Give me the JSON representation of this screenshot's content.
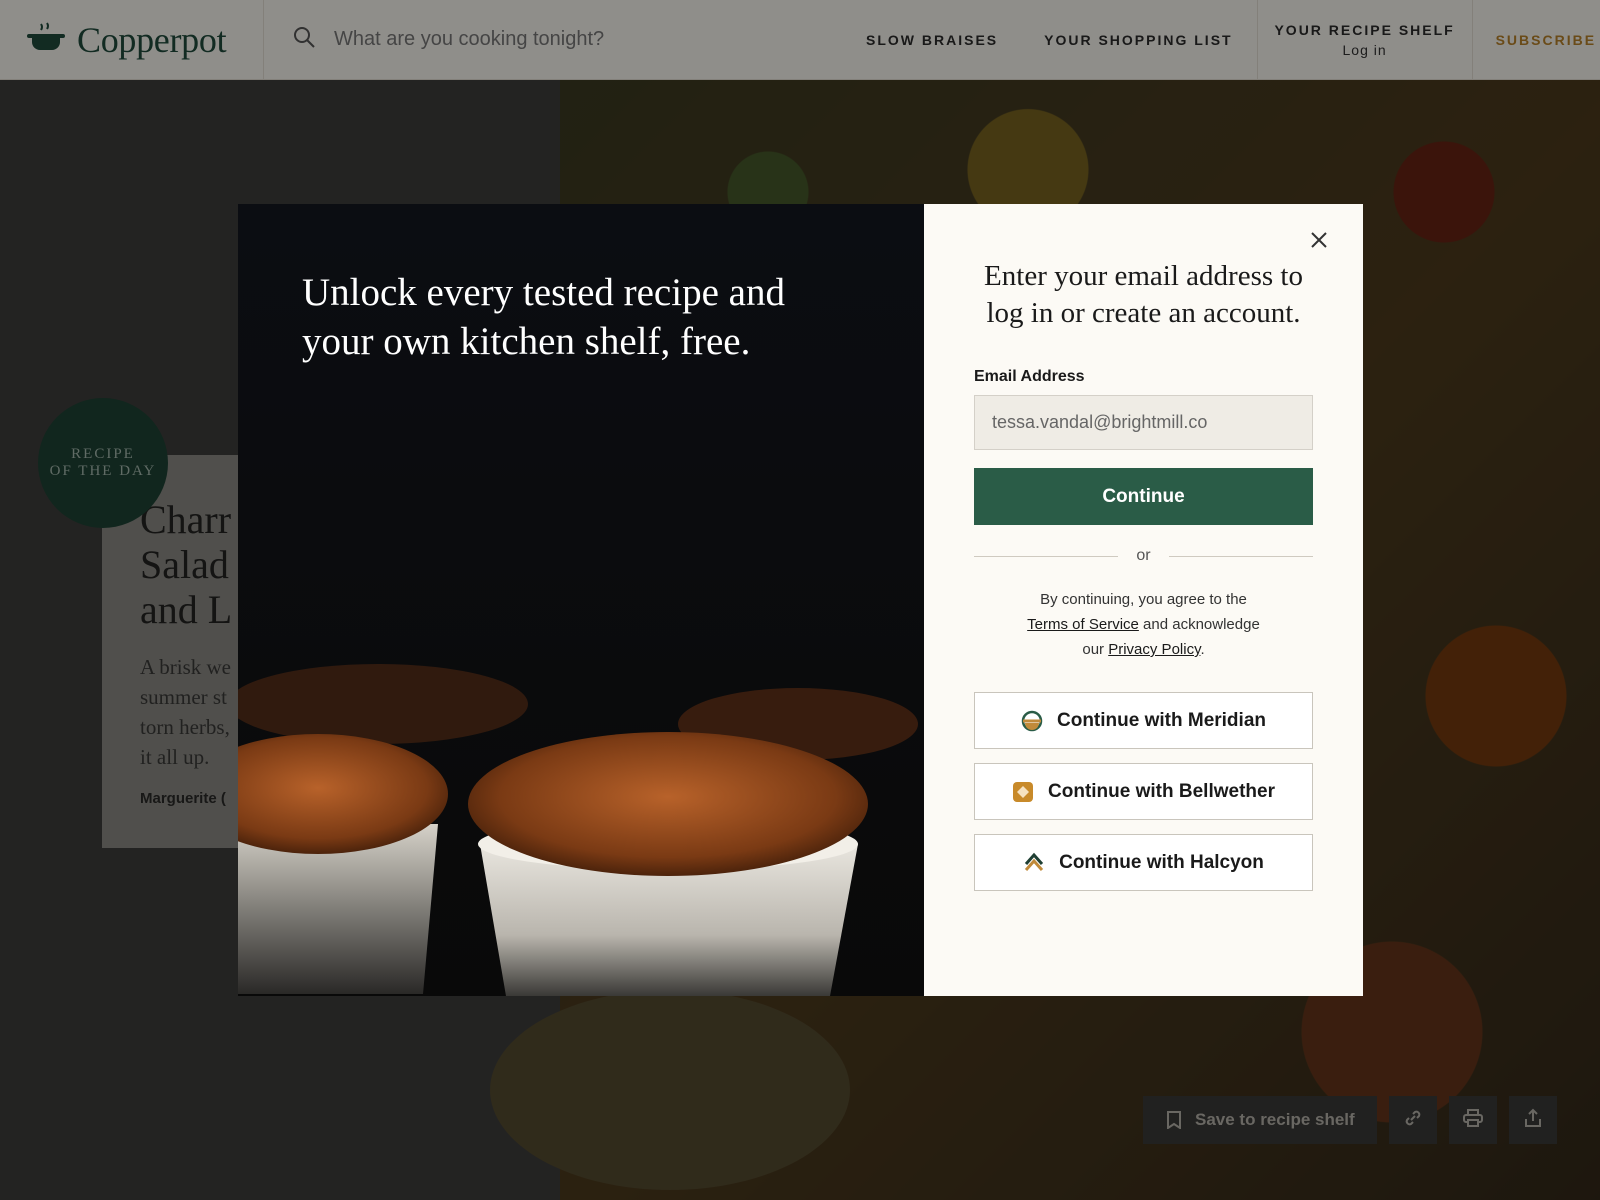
{
  "header": {
    "logo_text": "Copperpot",
    "search_placeholder": "What are you cooking tonight?",
    "nav": {
      "slow_braises": "SLOW BRAISES",
      "shopping_list": "YOUR SHOPPING LIST",
      "recipe_shelf": "YOUR RECIPE SHELF",
      "recipe_shelf_sub": "Log in",
      "subscribe": "SUBSCRIBE"
    }
  },
  "background": {
    "badge_line1": "RECIPE",
    "badge_line2": "OF THE DAY",
    "recipe_title_l1": "Charr",
    "recipe_title_l2": "Salad",
    "recipe_title_l3": "and L",
    "recipe_desc_l1": "A brisk we",
    "recipe_desc_l2": "summer st",
    "recipe_desc_l3": "torn herbs,",
    "recipe_desc_l4": "it all up.",
    "recipe_author": "Marguerite (",
    "save_label": "Save to recipe shelf"
  },
  "modal": {
    "hero_text": "Unlock every tested recipe and your own kitchen shelf, free.",
    "prompt": "Enter your email address to log in or create an account.",
    "email_label": "Email Address",
    "email_value": "tessa.vandal@brightmill.co",
    "continue_label": "Continue",
    "or_text": "or",
    "legal_pre": "By continuing, you agree to the",
    "terms_link": "Terms of Service",
    "legal_mid": "and acknowledge",
    "legal_our": "our",
    "privacy_link": "Privacy Policy",
    "legal_end": ".",
    "sso": [
      {
        "label": "Continue with Meridian",
        "icon": "meridian-icon"
      },
      {
        "label": "Continue with Bellwether",
        "icon": "bellwether-icon"
      },
      {
        "label": "Continue with Halcyon",
        "icon": "halcyon-icon"
      }
    ]
  },
  "colors": {
    "brand_green": "#2a5c47",
    "accent_copper": "#b7822a"
  }
}
